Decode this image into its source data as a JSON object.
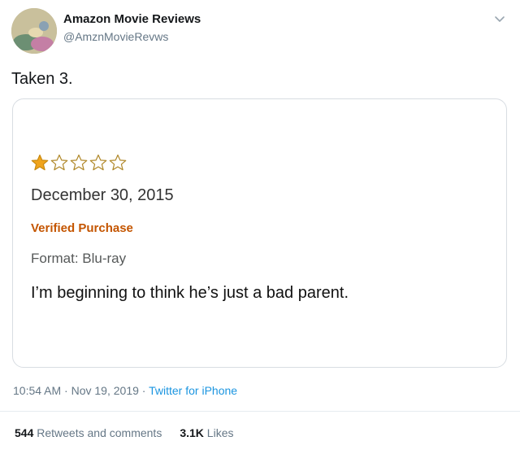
{
  "tweet": {
    "display_name": "Amazon Movie Reviews",
    "handle": "@AmznMovieRevws",
    "text": "Taken 3."
  },
  "review": {
    "rating": 1,
    "max_rating": 5,
    "star_color": "#f0a41c",
    "date": "December 30, 2015",
    "verified": "Verified Purchase",
    "format": "Format: Blu-ray",
    "body": "I’m beginning to think he’s just a bad parent."
  },
  "meta": {
    "time": "10:54 AM",
    "date": "Nov 19, 2019",
    "source": "Twitter for iPhone"
  },
  "stats": {
    "retweets_count": "544",
    "retweets_label": "Retweets and comments",
    "likes_count": "3.1K",
    "likes_label": "Likes"
  }
}
